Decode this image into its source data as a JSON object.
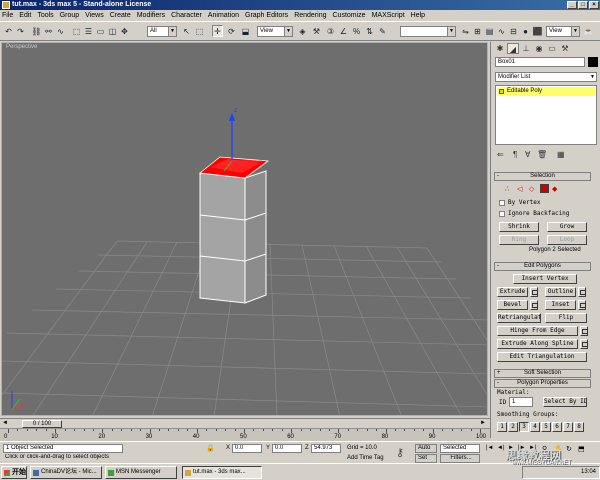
{
  "window": {
    "title": "tut.max - 3ds max 5 - Stand-alone License"
  },
  "menu": [
    "File",
    "Edit",
    "Tools",
    "Group",
    "Views",
    "Create",
    "Modifiers",
    "Character",
    "Animation",
    "Graph Editors",
    "Rendering",
    "Customize",
    "MAXScript",
    "Help"
  ],
  "toolbar": {
    "selection_filter": "All",
    "ref_coord": "View",
    "ref_coord2": "View",
    "named_sel": ""
  },
  "viewport": {
    "label": "Perspective"
  },
  "command_panel": {
    "object_name": "Box01",
    "modifier_list": "Modifier List",
    "stack_item": "Editable Poly",
    "selection": {
      "title": "Selection",
      "by_vertex": "By Vertex",
      "ignore_backfacing": "Ignore Backfacing",
      "shrink": "Shrink",
      "grow": "Grow",
      "ring": "Ring",
      "loop": "Loop",
      "status": "Polygon 2 Selected"
    },
    "edit_polygons": {
      "title": "Edit Polygons",
      "insert_vertex": "Insert Vertex",
      "extrude": "Extrude",
      "outline": "Outline",
      "bevel": "Bevel",
      "inset": "Inset",
      "retriangulate": "Retriangulate",
      "flip": "Flip",
      "hinge_from_edge": "Hinge From Edge",
      "extrude_along_spline": "Extrude Along Spline",
      "edit_triangulation": "Edit Triangulation"
    },
    "soft_selection": {
      "title": "Soft Selection"
    },
    "polygon_properties": {
      "title": "Polygon Properties",
      "material": "Material:",
      "id_label": "ID",
      "id_value": "1",
      "select_by_id": "Select By ID",
      "smoothing_groups": "Smoothing Groups:",
      "groups": [
        "1",
        "2",
        "3",
        "4",
        "5",
        "6",
        "7",
        "8"
      ]
    }
  },
  "time": {
    "slider": "0 / 100",
    "ticks": [
      "0",
      "10",
      "20",
      "30",
      "40",
      "50",
      "60",
      "70",
      "80",
      "90",
      "100"
    ],
    "slider_fraction": 0.0
  },
  "status": {
    "selected": "1 Object Selected",
    "prompt": "Click or click-and-drag to select objects",
    "x_label": "X",
    "x": "0.0",
    "y_label": "Y",
    "y": "0.0",
    "z_label": "Z",
    "z": "54.973",
    "grid": "Grid = 10.0",
    "add_time_tag": "Add Time Tag",
    "auto": "Auto",
    "set": "Set",
    "key_mode": "Selected",
    "filters": "Filters...",
    "set_k": "K"
  },
  "taskbar": {
    "start": "开始",
    "tasks": [
      "ChinaDV论坛 - Mic...",
      "MSN Messenger",
      "tut.max - 3ds max..."
    ],
    "clock": "13:04"
  },
  "watermark": {
    "text": "思缘教程网",
    "url": "www.MISSYUAN.NET"
  },
  "colors": {
    "viewport_bg": "#6e6e6e",
    "selection_red": "#ff0000",
    "title_blue": "#0a246a",
    "stack_yellow": "#ffff66"
  }
}
